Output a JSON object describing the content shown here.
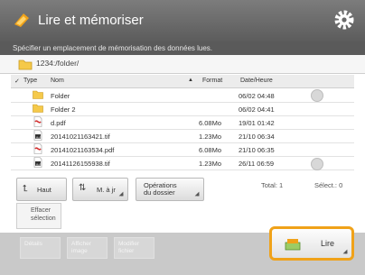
{
  "title": "Lire et mémoriser",
  "instruction": "Spécifier un emplacement de mémorisation des données lues.",
  "path": "1234:/folder/",
  "columns": {
    "check": "✓",
    "type": "Type",
    "name": "Nom",
    "format": "Format",
    "date": "Date/Heure"
  },
  "files": [
    {
      "type": "folder",
      "name": "Folder",
      "size": "",
      "date": "06/02 04:48"
    },
    {
      "type": "folder",
      "name": "Folder 2",
      "size": "",
      "date": "06/02 04:41"
    },
    {
      "type": "pdf",
      "name": "d.pdf",
      "size": "6.08Mo",
      "date": "19/01 01:42"
    },
    {
      "type": "tif",
      "name": "20141021163421.tif",
      "size": "1.23Mo",
      "date": "21/10 06:34"
    },
    {
      "type": "pdf",
      "name": "20141021163534.pdf",
      "size": "6.08Mo",
      "date": "21/10 06:35"
    },
    {
      "type": "tif",
      "name": "20141126155938.tif",
      "size": "1.23Mo",
      "date": "26/11 06:59"
    }
  ],
  "buttons": {
    "back": "Haut",
    "sort": "M. à jr",
    "folder_ops_line1": "Opérations",
    "folder_ops_line2": "du dossier"
  },
  "total": "Total: 1",
  "select": "Sélect.: 0",
  "clear_line1": "Effacer",
  "clear_line2": "sélection",
  "bottom": {
    "b1": "Détails",
    "b2_line1": "Afficher",
    "b2_line2": "image",
    "b3_line1": "Modifier",
    "b3_line2": "fichier",
    "read": "Lire"
  },
  "colors": {
    "accent": "#f0a219",
    "folder": "#f5c94a",
    "pdf": "#d32f2f"
  }
}
